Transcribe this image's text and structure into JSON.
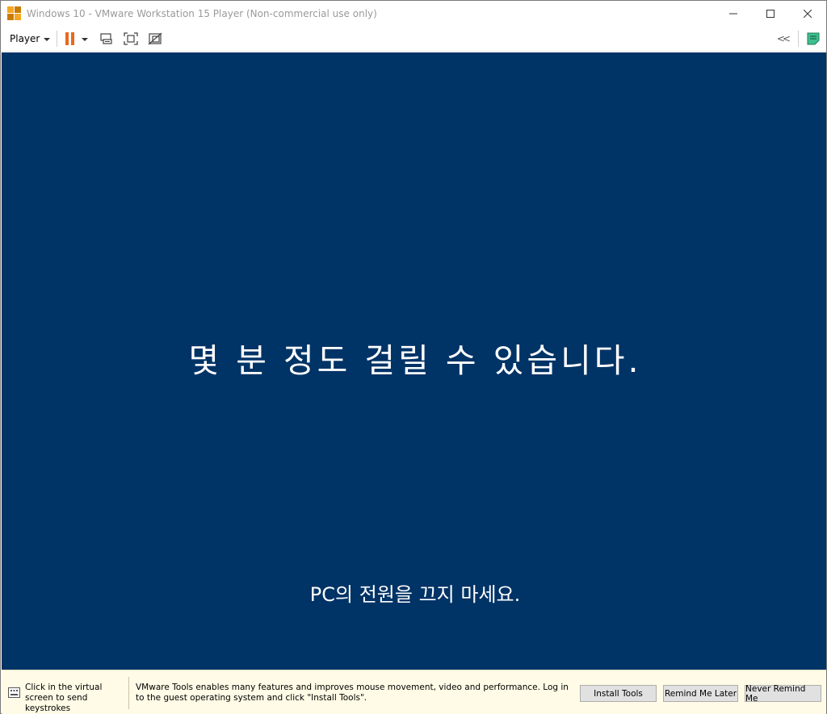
{
  "window": {
    "title": "Windows 10 - VMware Workstation 15 Player (Non-commercial use only)",
    "controls": {
      "minimize": "—",
      "maximize": "☐",
      "close": "✕"
    }
  },
  "toolbar": {
    "player_label": "Player",
    "icons": [
      "pause-icon",
      "send-ctrl-alt-del-icon",
      "fullscreen-icon",
      "unity-icon",
      "collapse-icon",
      "notes-icon"
    ]
  },
  "vm_screen": {
    "main_message": "몇 분 정도 걸릴 수 있습니다.",
    "sub_message": "PC의 전원을 끄지 마세요.",
    "background_color": "#003366"
  },
  "bottombar": {
    "hint": "Click in the virtual screen to send keystrokes",
    "tools_message": "VMware Tools enables many features and improves mouse movement, video and performance. Log in to the guest operating system and click \"Install Tools\".",
    "buttons": {
      "install": "Install Tools",
      "remind_later": "Remind Me Later",
      "never_remind": "Never Remind Me"
    }
  },
  "colors": {
    "accent": "#e8691e",
    "notification_bg": "#fffbe6"
  }
}
